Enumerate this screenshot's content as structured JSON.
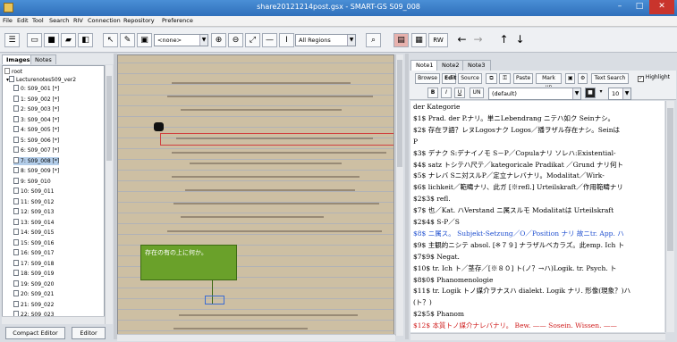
{
  "window": {
    "title": "share20121214post.gsx - SMART-GS S09_008",
    "min": "–",
    "max": "□",
    "close": "✕"
  },
  "menu": [
    "File",
    "Edit",
    "Tool",
    "Search",
    "RIV",
    "Connection",
    "Repository",
    "Preference"
  ],
  "toolbar": {
    "layer_combo": "<none>",
    "region_combo": "All Regions",
    "rw_label": "RW",
    "back": "←",
    "forward": "→",
    "up": "↑",
    "down": "↓"
  },
  "left_tabs": [
    "Images",
    "Notes"
  ],
  "tree": {
    "root": "root",
    "project": "Lecturenotes509_ver2",
    "items": [
      "0: S09_001 [*]",
      "1: S09_002 [*]",
      "2: S09_003 [*]",
      "3: S09_004 [*]",
      "4: S09_005 [*]",
      "5: S09_006 [*]",
      "6: S09_007 [*]",
      "7: S09_008 [*]",
      "8: S09_009 [*]",
      "9: S09_010",
      "10: S09_011",
      "11: S09_012",
      "12: S09_013",
      "13: S09_014",
      "14: S09_015",
      "15: S09_016",
      "16: S09_017",
      "17: S09_018",
      "18: S09_019",
      "19: S09_020",
      "20: S09_021",
      "21: S09_022",
      "22: S09_023"
    ],
    "selected_index": 7
  },
  "bottom_buttons": {
    "compact": "Compact Editor",
    "editor": "Editor"
  },
  "image_note": "存在の有の上に何か。",
  "right_tabs": [
    "Note1",
    "Note2",
    "Note3"
  ],
  "right_toolbar": {
    "browse": "Browse",
    "edit": "Edit",
    "source": "Source",
    "paste": "Paste",
    "markup": "Mark up",
    "text_search": "Text Search",
    "highlight": "Highlight",
    "bold": "B",
    "italic": "I",
    "underline": "U",
    "un": "UN",
    "font": "(default)",
    "size": "10"
  },
  "editor_lines": [
    {
      "text": "der Kategorie",
      "style": ""
    },
    {
      "text": "$1$ Prad. der P.ナリ。単ニLebendrang ニテハ如ク Seinナシ。",
      "style": ""
    },
    {
      "text": "$2$ 存在ヲ語？レヌLogosナク Logos／播ヲザル存在ナシ。Seinは",
      "style": ""
    },
    {
      "text": "P",
      "style": ""
    },
    {
      "text": "$3$ デナク S:デナイノモ S－P／Copulaナリ ソレハ:Existential-",
      "style": ""
    },
    {
      "text": "$4$ satz トシテハ尺テ／kategoricale Pradikat ／Grund ナリ何ト",
      "style": ""
    },
    {
      "text": "$5$ ナレバ Sニ対スルP／定立ナレバナリ。Modalitat／Wirk-",
      "style": ""
    },
    {
      "text": "$6$ lichkeit／範疇ナリ、此ガ [※refl.] Urteilskraft／作用範疇ナリ",
      "style": ""
    },
    {
      "text": "$2$3$                                         refl.",
      "style": ""
    },
    {
      "text": "$7$ 也／Kat. ハVerstand ニ属スルモ Modalitatは Urteilskraft",
      "style": ""
    },
    {
      "text": "$2$4$                                S-P／S",
      "style": ""
    },
    {
      "text": "$8$ ニ属ス。 Subjekt-Setzung／O／Position ナリ 故ニtr. App. ハ",
      "style": "blue"
    },
    {
      "text": "$9$ 主観的ニシテ absol. [※７９] ナラザルベカラズ。此emp. Ich ト",
      "style": ""
    },
    {
      "text": "$7$9$                               Negat.",
      "style": ""
    },
    {
      "text": "$10$ tr. Ich ト／茎存／[※８０] ト(ノ？→ハ)Logik. tr. Psych. ト",
      "style": ""
    },
    {
      "text": "$8$0$                       Phanomenologie",
      "style": ""
    },
    {
      "text": "$11$ tr. Logik トノ媒介ヲナスハ dialekt. Logik ナリ. 形像(現象？)ハ",
      "style": ""
    },
    {
      "text": "(ト？)",
      "style": ""
    },
    {
      "text": "$2$5$                                         Phanom",
      "style": ""
    },
    {
      "text": "$12$ 本質トノ媒介ナレバナリ。 Bew. —— Sosein. Wissen. ——",
      "style": "red"
    }
  ],
  "colors": {
    "titlebar": "#2f6fba",
    "selection": "#b3cde9",
    "note": "#6aa12a",
    "redbox": "#d04040",
    "close": "#c9342c"
  }
}
